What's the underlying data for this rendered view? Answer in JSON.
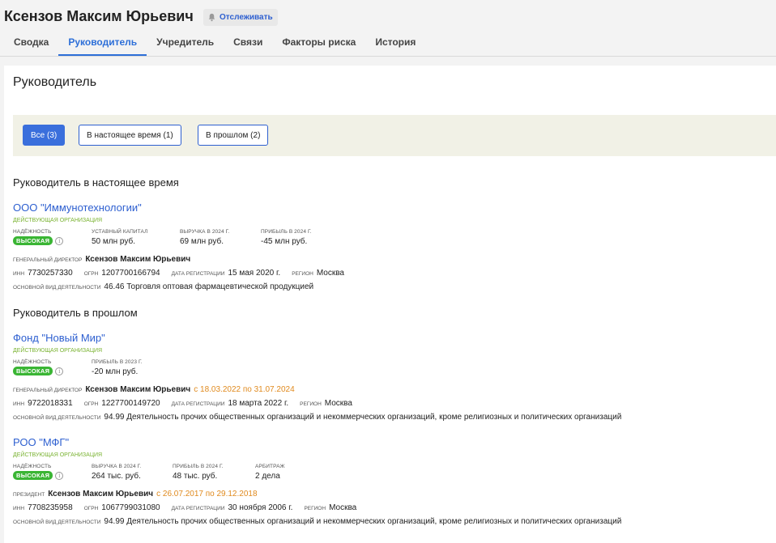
{
  "header": {
    "person_name": "Ксензов Максим Юрьевич",
    "follow_label": "Отслеживать"
  },
  "tabs": [
    {
      "label": "Сводка",
      "active": false
    },
    {
      "label": "Руководитель",
      "active": true
    },
    {
      "label": "Учредитель",
      "active": false
    },
    {
      "label": "Связи",
      "active": false
    },
    {
      "label": "Факторы риска",
      "active": false
    },
    {
      "label": "История",
      "active": false
    }
  ],
  "section_title": "Руководитель",
  "filters": [
    {
      "label": "Все (3)",
      "active": true
    },
    {
      "label": "В настоящее время (1)",
      "active": false
    },
    {
      "label": "В прошлом (2)",
      "active": false
    }
  ],
  "current_title": "Руководитель в настоящее время",
  "past_title": "Руководитель в прошлом",
  "labels": {
    "reliability": "надёжность",
    "inn": "ИНН",
    "ogrn": "ОГРН",
    "reg_date": "дата регистрации",
    "region": "регион",
    "activity": "основной вид деятельности"
  },
  "colors": {
    "accent": "#2d5fd0",
    "active_tab": "#2d6fd8",
    "status_green": "#7ab332",
    "badge_green": "#3ab534",
    "period_orange": "#e08a1e",
    "filter_bg": "#f1f1e6"
  },
  "orgs": [
    {
      "name": "ООО \"Иммунотехнологии\"",
      "status": "действующая организация",
      "reliability": "высокая",
      "metrics": [
        {
          "label": "уставный капитал",
          "value": "50 млн руб."
        },
        {
          "label": "выручка в 2024 г.",
          "value": "69 млн руб."
        },
        {
          "label": "прибыль в 2024 г.",
          "value": "-45 млн руб."
        }
      ],
      "role": "генеральный директор",
      "director": "Ксензов Максим Юрьевич",
      "period": "",
      "inn": "7730257330",
      "ogrn": "1207700166794",
      "reg_date": "15 мая 2020 г.",
      "region": "Москва",
      "activity": "46.46 Торговля оптовая фармацевтической продукцией"
    },
    {
      "name": "Фонд \"Новый Мир\"",
      "status": "действующая организация",
      "reliability": "высокая",
      "metrics": [
        {
          "label": "прибыль в 2023 г.",
          "value": "-20 млн руб."
        }
      ],
      "role": "генеральный директор",
      "director": "Ксензов Максим Юрьевич",
      "period": "с 18.03.2022 по 31.07.2024",
      "inn": "9722018331",
      "ogrn": "1227700149720",
      "reg_date": "18 марта 2022 г.",
      "region": "Москва",
      "activity": "94.99 Деятельность прочих общественных организаций и некоммерческих организаций, кроме религиозных и политических организаций"
    },
    {
      "name": "РОО \"МФГ\"",
      "status": "действующая организация",
      "reliability": "высокая",
      "metrics": [
        {
          "label": "выручка в 2024 г.",
          "value": "264 тыс. руб."
        },
        {
          "label": "прибыль в 2024 г.",
          "value": "48 тыс. руб."
        },
        {
          "label": "арбитраж",
          "value": "2 дела"
        }
      ],
      "role": "президент",
      "director": "Ксензов Максим Юрьевич",
      "period": "с 26.07.2017 по 29.12.2018",
      "inn": "7708235958",
      "ogrn": "1067799031080",
      "reg_date": "30 ноября 2006 г.",
      "region": "Москва",
      "activity": "94.99 Деятельность прочих общественных организаций и некоммерческих организаций, кроме религиозных и политических организаций"
    }
  ]
}
